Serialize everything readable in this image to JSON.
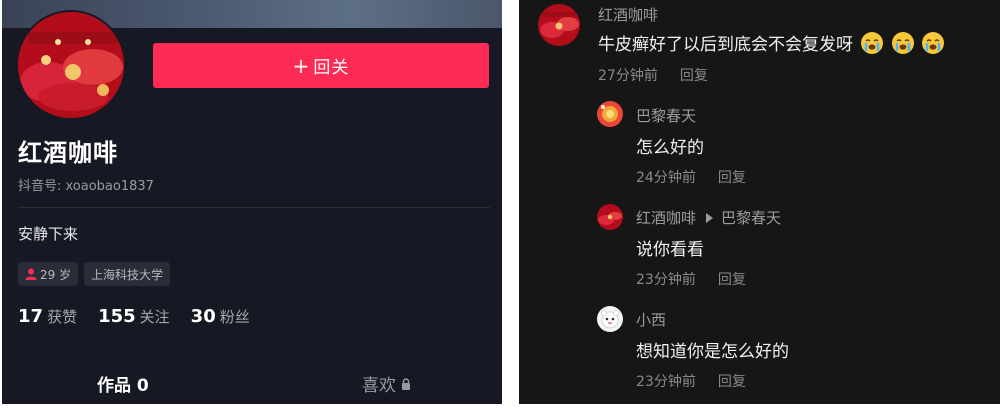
{
  "profile": {
    "follow_button": "+ 回关",
    "follow_plus": "+",
    "follow_label": "回关",
    "nickname": "红酒咖啡",
    "douyin_id": "抖音号: xoaobao1837",
    "bio": "安静下来",
    "tags": {
      "age": "29 岁",
      "school": "上海科技大学"
    },
    "stats": [
      {
        "num": "17",
        "label": "获赞"
      },
      {
        "num": "155",
        "label": "关注"
      },
      {
        "num": "30",
        "label": "粉丝"
      }
    ],
    "tabs": {
      "works": "作品 0",
      "likes": "喜欢"
    },
    "colors": {
      "bg": "#161823",
      "accent": "#fe2c55"
    }
  },
  "comments": {
    "main": {
      "author": "红酒咖啡",
      "text": "牛皮癣好了以后到底会不会复发呀",
      "emoji": [
        "crying-face",
        "crying-face",
        "crying-face"
      ],
      "time": "27分钟前",
      "reply": "回复"
    },
    "replies": [
      {
        "author": "巴黎春天",
        "reply_to": "",
        "text": "怎么好的",
        "time": "24分钟前",
        "reply": "回复"
      },
      {
        "author": "红酒咖啡",
        "reply_to": "巴黎春天",
        "text": "说你看看",
        "time": "23分钟前",
        "reply": "回复"
      },
      {
        "author": "小西",
        "reply_to": "",
        "text": "想知道你是怎么好的",
        "time": "23分钟前",
        "reply": "回复"
      }
    ]
  }
}
